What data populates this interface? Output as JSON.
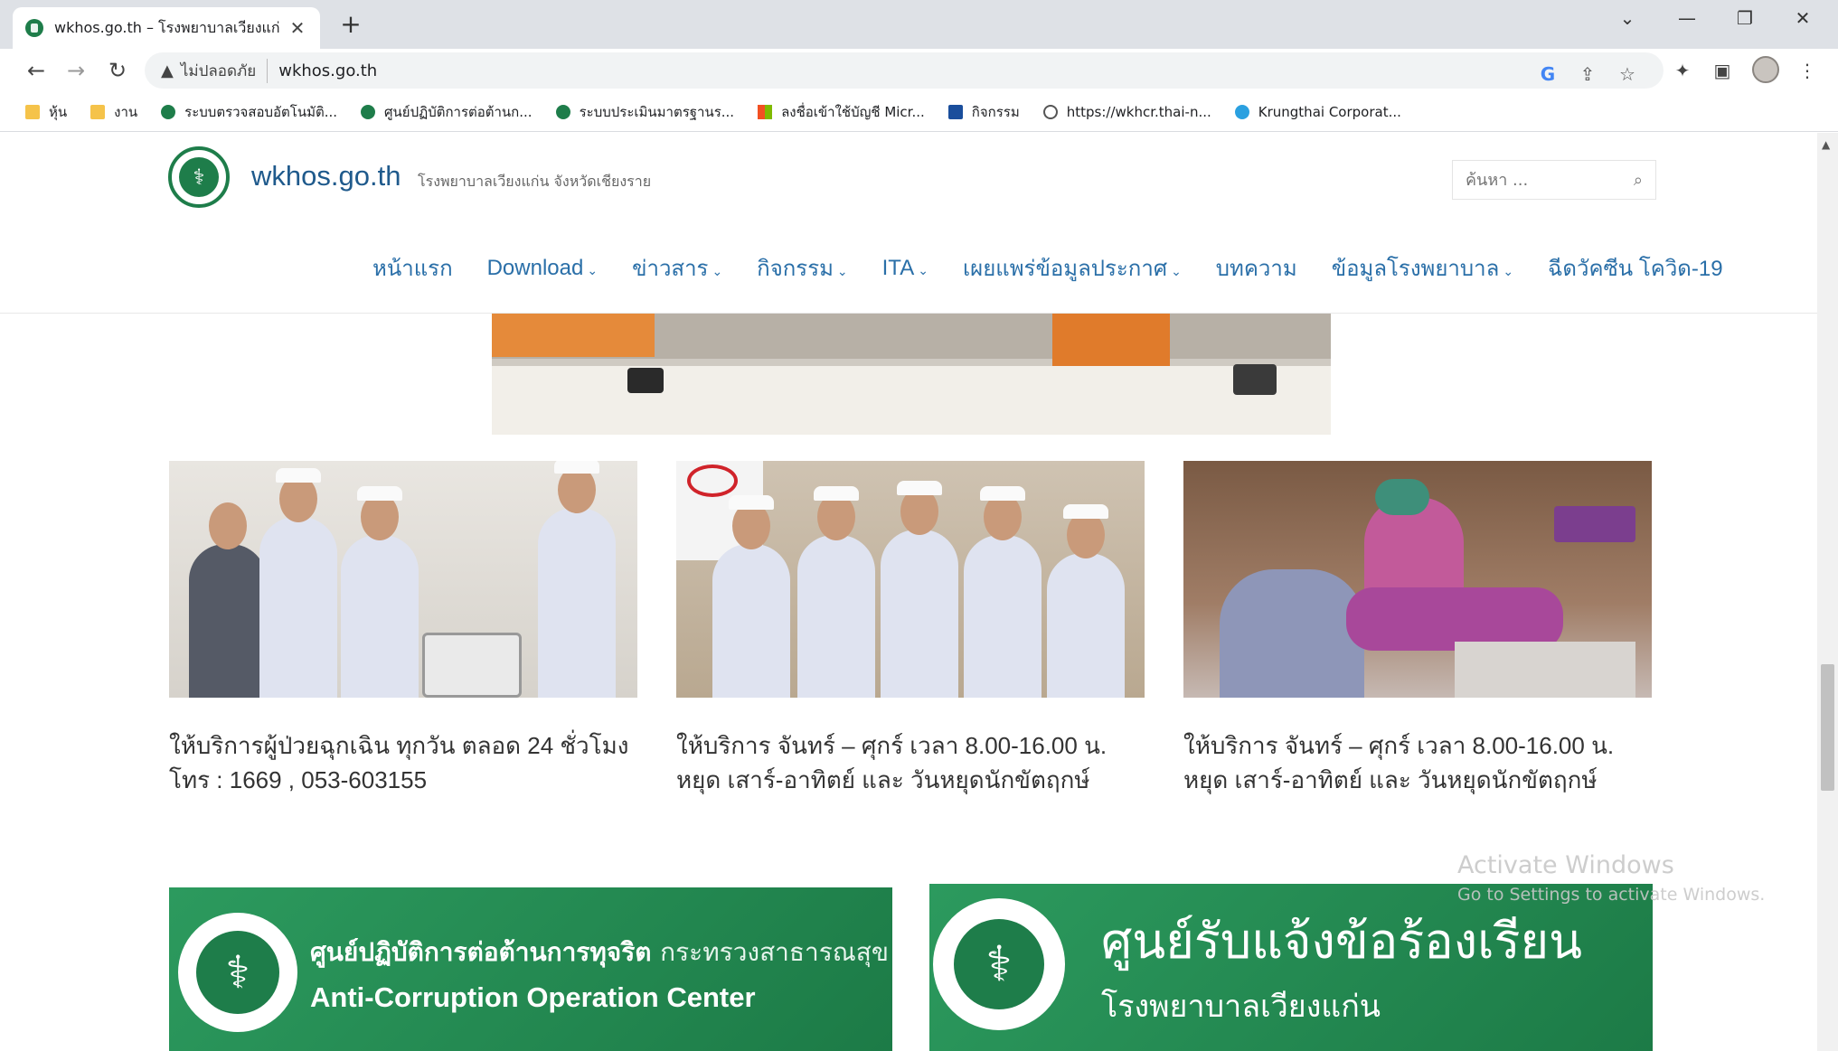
{
  "browser": {
    "tab_title": "wkhos.go.th – โรงพยาบาลเวียงแก่น",
    "tab_close": "✕",
    "new_tab": "+",
    "window_controls": {
      "dropdown": "⌄",
      "minimize": "—",
      "restore": "❐",
      "close": "✕"
    },
    "nav": {
      "back": "←",
      "forward": "→",
      "reload": "↻"
    },
    "address": {
      "warning_icon": "▲",
      "insecure_label": "ไม่ปลอดภัย",
      "url": "wkhos.go.th"
    },
    "toolbar_icons": {
      "google": "G",
      "share": "⇪",
      "star": "☆",
      "extensions": "✦",
      "sidebar": "▣",
      "menu": "⋮"
    },
    "bookmarks": [
      {
        "icon": "folder",
        "label": "หุ้น"
      },
      {
        "icon": "folder",
        "label": "งาน"
      },
      {
        "icon": "moph",
        "label": "ระบบตรวจสอบอัตโนมัติ..."
      },
      {
        "icon": "moph",
        "label": "ศูนย์ปฏิบัติการต่อต้านก..."
      },
      {
        "icon": "moph",
        "label": "ระบบประเมินมาตรฐานร..."
      },
      {
        "icon": "ms",
        "label": "ลงชื่อเข้าใช้บัญชี Micr..."
      },
      {
        "icon": "cal",
        "label": "กิจกรรม"
      },
      {
        "icon": "globe",
        "label": "https://wkhcr.thai-n..."
      },
      {
        "icon": "ktb",
        "label": "Krungthai Corporat..."
      }
    ]
  },
  "site": {
    "logo_glyph": "⚕",
    "title": "wkhos.go.th",
    "tagline": "โรงพยาบาลเวียงแก่น จังหวัดเชียงราย",
    "search_placeholder": "ค้นหา ...",
    "search_icon": "⌕",
    "menu": [
      {
        "label": "หน้าแรก",
        "caret": ""
      },
      {
        "label": "Download",
        "caret": "⌄"
      },
      {
        "label": "ข่าวสาร",
        "caret": "⌄"
      },
      {
        "label": "กิจกรรม",
        "caret": "⌄"
      },
      {
        "label": "ITA",
        "caret": "⌄"
      },
      {
        "label": "เผยแพร่ข้อมูลประกาศ",
        "caret": "⌄"
      },
      {
        "label": "บทความ",
        "caret": ""
      },
      {
        "label": "ข้อมูลโรงพยาบาล",
        "caret": "⌄"
      },
      {
        "label": "ฉีดวัคซีน โควิด-19",
        "caret": ""
      }
    ]
  },
  "cards": [
    {
      "line1": "ให้บริการผู้ป่วยฉุกเฉิน ทุกวัน ตลอด 24 ชั่วโมง",
      "line2": "โทร : 1669 , 053-603155"
    },
    {
      "line1": "ให้บริการ จันทร์ – ศุกร์ เวลา 8.00-16.00 น.",
      "line2": "หยุด เสาร์-อาทิตย์ และ วันหยุดนักขัตฤกษ์"
    },
    {
      "line1": "ให้บริการ จันทร์ – ศุกร์ เวลา 8.00-16.00 น.",
      "line2": "หยุด เสาร์-อาทิตย์ และ วันหยุดนักขัตฤกษ์"
    }
  ],
  "banners": {
    "anticorruption": {
      "thai_bold": "ศูนย์ปฏิบัติการต่อต้านการทุจริต",
      "thai_light": "กระทรวงสาธารณสุข",
      "english": "Anti-Corruption Operation Center"
    },
    "complaint": {
      "title": "ศูนย์รับแจ้งข้อร้องเรียน",
      "subtitle": "โรงพยาบาลเวียงแก่น"
    }
  },
  "watermark": {
    "line1": "Activate Windows",
    "line2": "Go to Settings to activate Windows."
  },
  "colors": {
    "brand_green": "#1e7d4a",
    "menu_blue": "#2a6fa8",
    "title_blue": "#1f5a8c"
  }
}
